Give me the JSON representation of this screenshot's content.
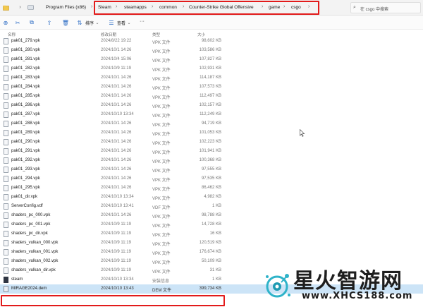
{
  "address": {
    "nav_back": "←",
    "nav_forward": "→",
    "breadcrumb_before": [
      "Program Files (x86)"
    ],
    "breadcrumb_boxed": [
      "Steam",
      "steamapps",
      "common",
      "Counter-Strike Global Offensive",
      "game",
      "csgo"
    ],
    "search_placeholder": "在 csgo 中搜索"
  },
  "toolbar": {
    "sort_label": "排序",
    "view_label": "查看",
    "more_label": "···"
  },
  "columns": {
    "name": "名称",
    "date": "修改日期",
    "type": "类型",
    "size": "大小"
  },
  "files": [
    {
      "name": "pak01_279.vpk",
      "date": "2024/8/22 19:22",
      "type": "VPK 文件",
      "size": "98,602 KB",
      "icon": "file"
    },
    {
      "name": "pak01_280.vpk",
      "date": "2024/10/1 14:26",
      "type": "VPK 文件",
      "size": "103,586 KB",
      "icon": "file"
    },
    {
      "name": "pak01_281.vpk",
      "date": "2024/10/4 15:06",
      "type": "VPK 文件",
      "size": "107,827 KB",
      "icon": "file"
    },
    {
      "name": "pak01_282.vpk",
      "date": "2024/10/9 11:19",
      "type": "VPK 文件",
      "size": "102,931 KB",
      "icon": "file"
    },
    {
      "name": "pak01_283.vpk",
      "date": "2024/10/1 14:26",
      "type": "VPK 文件",
      "size": "114,187 KB",
      "icon": "file"
    },
    {
      "name": "pak01_284.vpk",
      "date": "2024/10/1 14:26",
      "type": "VPK 文件",
      "size": "107,573 KB",
      "icon": "file"
    },
    {
      "name": "pak01_285.vpk",
      "date": "2024/10/1 14:26",
      "type": "VPK 文件",
      "size": "112,497 KB",
      "icon": "file"
    },
    {
      "name": "pak01_286.vpk",
      "date": "2024/10/1 14:26",
      "type": "VPK 文件",
      "size": "102,157 KB",
      "icon": "file"
    },
    {
      "name": "pak01_287.vpk",
      "date": "2024/10/10 13:34",
      "type": "VPK 文件",
      "size": "112,249 KB",
      "icon": "file"
    },
    {
      "name": "pak01_288.vpk",
      "date": "2024/10/1 14:26",
      "type": "VPK 文件",
      "size": "94,719 KB",
      "icon": "file"
    },
    {
      "name": "pak01_289.vpk",
      "date": "2024/10/1 14:26",
      "type": "VPK 文件",
      "size": "101,053 KB",
      "icon": "file"
    },
    {
      "name": "pak01_290.vpk",
      "date": "2024/10/1 14:26",
      "type": "VPK 文件",
      "size": "102,223 KB",
      "icon": "file"
    },
    {
      "name": "pak01_291.vpk",
      "date": "2024/10/1 14:26",
      "type": "VPK 文件",
      "size": "101,941 KB",
      "icon": "file"
    },
    {
      "name": "pak01_292.vpk",
      "date": "2024/10/1 14:26",
      "type": "VPK 文件",
      "size": "100,368 KB",
      "icon": "file"
    },
    {
      "name": "pak01_293.vpk",
      "date": "2024/10/1 14:26",
      "type": "VPK 文件",
      "size": "97,555 KB",
      "icon": "file"
    },
    {
      "name": "pak01_294.vpk",
      "date": "2024/10/1 14:26",
      "type": "VPK 文件",
      "size": "97,535 KB",
      "icon": "file"
    },
    {
      "name": "pak01_295.vpk",
      "date": "2024/10/1 14:26",
      "type": "VPK 文件",
      "size": "86,462 KB",
      "icon": "file"
    },
    {
      "name": "pak01_dir.vpk",
      "date": "2024/10/10 13:34",
      "type": "VPK 文件",
      "size": "4,982 KB",
      "icon": "file"
    },
    {
      "name": "ServerConfig.vdf",
      "date": "2024/10/10 13:41",
      "type": "VDF 文件",
      "size": "1 KB",
      "icon": "file"
    },
    {
      "name": "shaders_pc_000.vpk",
      "date": "2024/10/1 14:26",
      "type": "VPK 文件",
      "size": "98,788 KB",
      "icon": "file"
    },
    {
      "name": "shaders_pc_001.vpk",
      "date": "2024/10/9 11:19",
      "type": "VPK 文件",
      "size": "14,728 KB",
      "icon": "file"
    },
    {
      "name": "shaders_pc_dir.vpk",
      "date": "2024/10/9 11:19",
      "type": "VPK 文件",
      "size": "16 KB",
      "icon": "file"
    },
    {
      "name": "shaders_vulkan_000.vpk",
      "date": "2024/10/9 11:19",
      "type": "VPK 文件",
      "size": "120,519 KB",
      "icon": "file"
    },
    {
      "name": "shaders_vulkan_001.vpk",
      "date": "2024/10/9 11:19",
      "type": "VPK 文件",
      "size": "176,674 KB",
      "icon": "file"
    },
    {
      "name": "shaders_vulkan_002.vpk",
      "date": "2024/10/9 11:19",
      "type": "VPK 文件",
      "size": "50,109 KB",
      "icon": "file"
    },
    {
      "name": "shaders_vulkan_dir.vpk",
      "date": "2024/10/9 11:19",
      "type": "VPK 文件",
      "size": "31 KB",
      "icon": "file"
    },
    {
      "name": "steam",
      "date": "2024/10/10 13:34",
      "type": "安装信息",
      "size": "1 KB",
      "icon": "exe"
    },
    {
      "name": "MIRAGE2024.dem",
      "date": "2024/10/10 13:43",
      "type": "DEM 文件",
      "size": "399,734 KB",
      "icon": "dem",
      "selected": true
    }
  ],
  "watermark": {
    "name": "星火智游网",
    "url": "www.XHCS188.com"
  },
  "colors": {
    "highlight_box": "#e21b1b",
    "selected_row": "#cce4f7",
    "accent": "#2b6bc4"
  }
}
